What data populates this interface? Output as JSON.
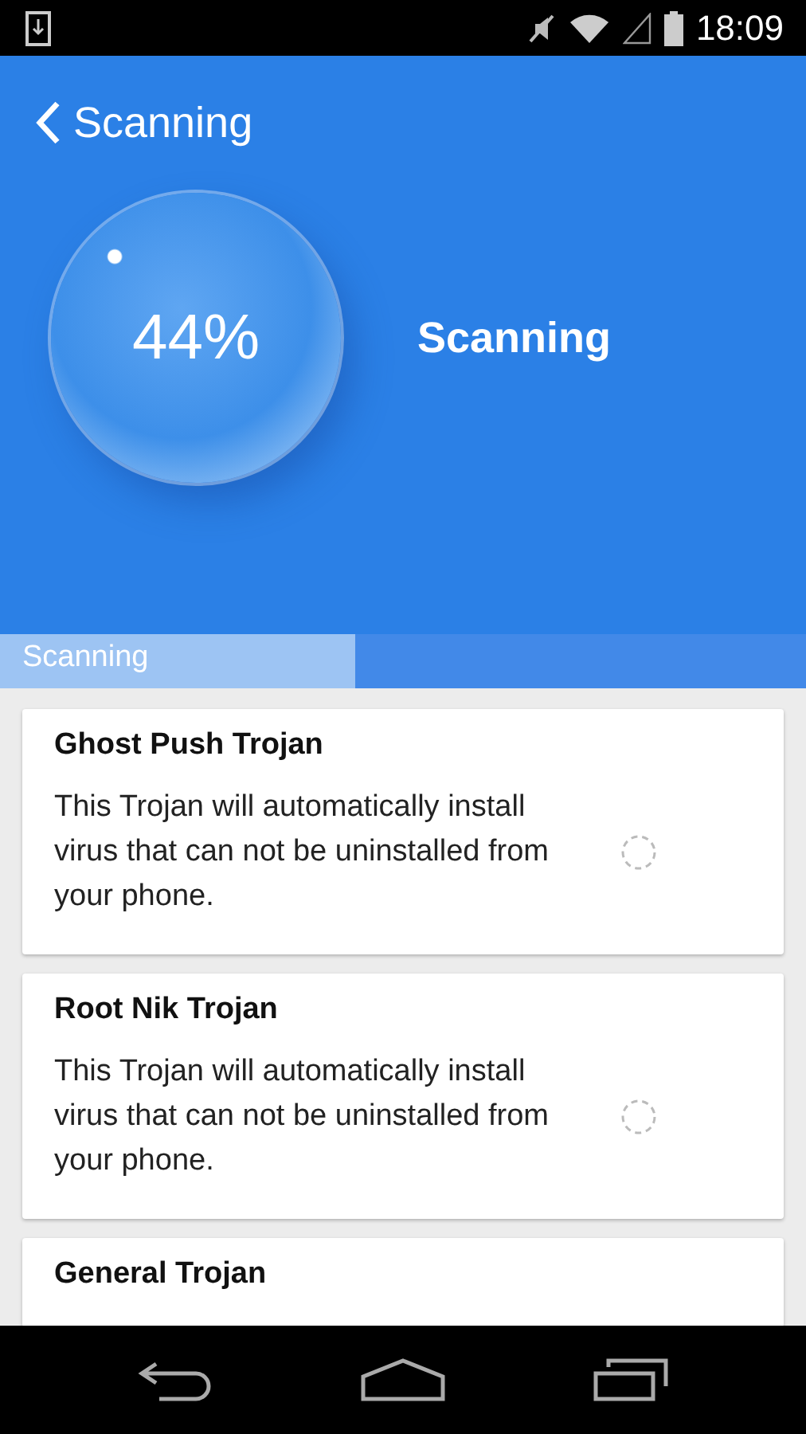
{
  "status_bar": {
    "time": "18:09"
  },
  "app_bar": {
    "title": "Scanning"
  },
  "scan": {
    "percent": "44%",
    "status": "Scanning"
  },
  "progress": {
    "label": "Scanning",
    "level": 0.44
  },
  "threats": [
    {
      "name": "Ghost Push Trojan",
      "description": "This Trojan will automatically install virus that can not be uninstalled from your phone."
    },
    {
      "name": "Root Nik Trojan",
      "description": "This Trojan will automatically install virus that can not be uninstalled from your phone."
    },
    {
      "name": "General Trojan"
    }
  ]
}
